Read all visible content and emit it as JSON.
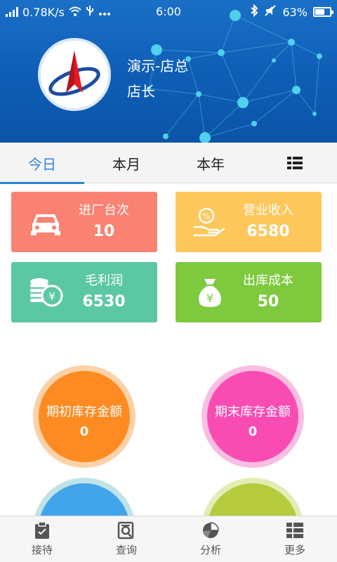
{
  "status_bar": {
    "net_speed": "0.78K/s",
    "time": "6:00",
    "battery": "63%",
    "battery_level": 0.63,
    "icons": [
      "signal-icon",
      "wifi-icon",
      "usb-icon",
      "more-dots-icon",
      "bluetooth-icon",
      "mute-icon",
      "battery-icon"
    ]
  },
  "profile": {
    "name": "演示-店总",
    "role": "店长",
    "logo_icon": "company-logo"
  },
  "tabs": {
    "items": [
      {
        "label": "今日",
        "active": true
      },
      {
        "label": "本月",
        "active": false
      },
      {
        "label": "本年",
        "active": false
      }
    ],
    "menu_icon": "list-menu-icon"
  },
  "cards": [
    {
      "label": "进厂台次",
      "value": "10",
      "icon": "car-icon",
      "color": "#f98272"
    },
    {
      "label": "营业收入",
      "value": "6580",
      "icon": "revenue-hand-icon",
      "color": "#fdc75b"
    },
    {
      "label": "毛利润",
      "value": "6530",
      "icon": "coins-icon",
      "color": "#5cc8a3"
    },
    {
      "label": "出库成本",
      "value": "50",
      "icon": "money-bag-icon",
      "color": "#7ec93e"
    }
  ],
  "circles": [
    {
      "label": "期初库存金额",
      "value": "0",
      "color": "#fe8b22",
      "ring": "#fdd2a8"
    },
    {
      "label": "期末库存金额",
      "value": "0",
      "color": "#f94cb3",
      "ring": "#f9bfe3"
    },
    {
      "label": "",
      "value": "",
      "color": "#42a4ea",
      "ring": "#c0e3e7"
    },
    {
      "label": "",
      "value": "",
      "color": "#b5cb3c",
      "ring": "#e4ecb5"
    }
  ],
  "bottom_nav": [
    {
      "label": "接待",
      "icon": "clipboard-icon"
    },
    {
      "label": "查询",
      "icon": "search-doc-icon"
    },
    {
      "label": "分析",
      "icon": "pie-chart-icon"
    },
    {
      "label": "更多",
      "icon": "more-list-icon"
    }
  ],
  "colors": {
    "accent": "#2b86d8",
    "banner": "#0e5db5"
  }
}
